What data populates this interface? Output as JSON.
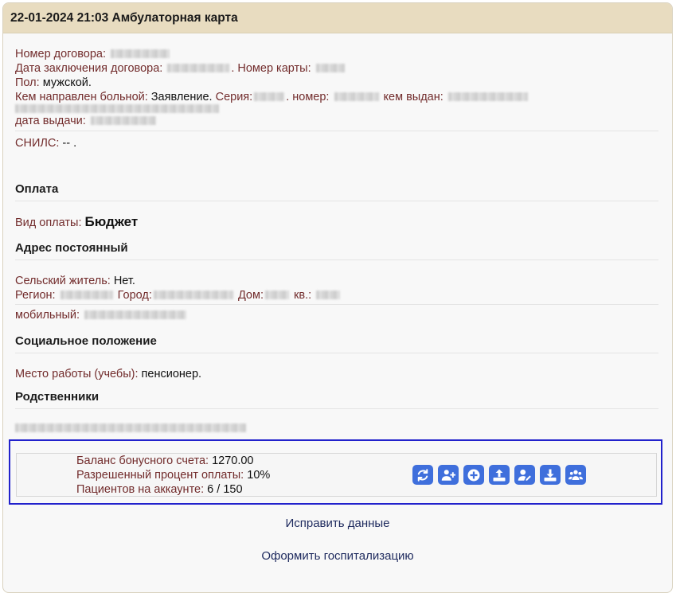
{
  "header": {
    "title": "22-01-2024 21:03 Амбулаторная карта"
  },
  "patient": {
    "contract_label": "Номер договора:",
    "contract_date_label": "Дата заключения договора:",
    "card_label": ". Номер карты:",
    "sex_label": "Пол:",
    "sex_value": "мужской.",
    "referral_label": "Кем направлен больной:",
    "referral_value": "Заявление.",
    "series_label": "Серия:",
    "number_label": ". номер:",
    "issued_by_label": "кем выдан:",
    "issue_date_label": "дата выдачи:",
    "snils_label": "СНИЛС:",
    "snils_value": "-- ."
  },
  "payment": {
    "title": "Оплата",
    "type_label": "Вид оплаты:",
    "type_value": "Бюджет"
  },
  "address": {
    "title": "Адрес постоянный",
    "rural_label": "Сельский житель:",
    "rural_value": "Нет.",
    "region_label": "Регион:",
    "city_label": "Город:",
    "house_label": "Дом:",
    "apt_label": "кв.:",
    "mobile_label": "мобильный:"
  },
  "social": {
    "title": "Социальное положение",
    "work_label": "Место работы (учебы):",
    "work_value": "пенсионер."
  },
  "relatives": {
    "title": "Родственники"
  },
  "bonus": {
    "balance_label": "Баланс бонусного счета:",
    "balance_value": "1270.00",
    "percent_label": "Разрешенный процент оплаты:",
    "percent_value": "10%",
    "patients_label": "Пациентов на аккаунте:",
    "patients_value": "6 / 150",
    "buttons": [
      "refresh-icon",
      "user-plus-icon",
      "plus-circle-icon",
      "upload-icon",
      "user-edit-icon",
      "download-icon",
      "users-icon"
    ]
  },
  "actions": {
    "edit_label": "Исправить данные",
    "hospitalize_label": "Оформить госпитализацию"
  },
  "colors": {
    "label": "#722c2c",
    "header_bg": "#e8dcc0",
    "button": "#3f6fdc",
    "highlight_border": "#2222cc",
    "link": "#1e2a5e"
  }
}
